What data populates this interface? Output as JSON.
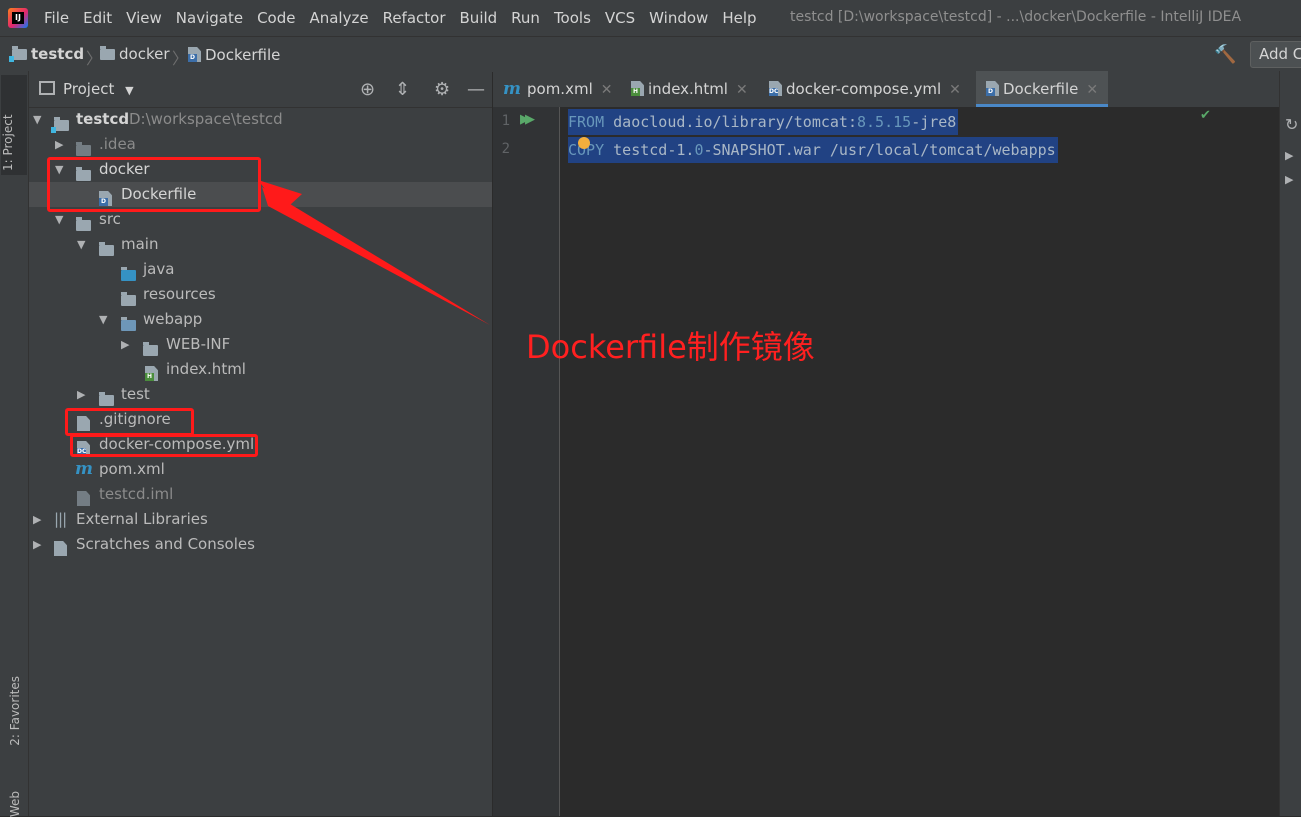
{
  "app": {
    "menu": [
      "File",
      "Edit",
      "View",
      "Navigate",
      "Code",
      "Analyze",
      "Refactor",
      "Build",
      "Run",
      "Tools",
      "VCS",
      "Window",
      "Help"
    ],
    "window_title": "testcd [D:\\workspace\\testcd] - ...\\docker\\Dockerfile - IntelliJ IDEA"
  },
  "navbar": {
    "crumbs": [
      "testcd",
      "docker",
      "Dockerfile"
    ],
    "add_config_label": "Add C"
  },
  "stripe": {
    "project_tab": "1: Project",
    "favorites_tab": "2: Favorites",
    "web_tab": "Web"
  },
  "project_panel": {
    "title": "Project",
    "tree": [
      {
        "label": "testcd",
        "path": "D:\\workspace\\testcd"
      },
      {
        "label": ".idea"
      },
      {
        "label": "docker"
      },
      {
        "label": "Dockerfile"
      },
      {
        "label": "src"
      },
      {
        "label": "main"
      },
      {
        "label": "java"
      },
      {
        "label": "resources"
      },
      {
        "label": "webapp"
      },
      {
        "label": "WEB-INF"
      },
      {
        "label": "index.html"
      },
      {
        "label": "test"
      },
      {
        "label": ".gitignore"
      },
      {
        "label": "docker-compose.yml"
      },
      {
        "label": "pom.xml"
      },
      {
        "label": "testcd.iml"
      },
      {
        "label": "External Libraries"
      },
      {
        "label": "Scratches and Consoles"
      }
    ]
  },
  "editor": {
    "tabs": [
      {
        "label": "pom.xml"
      },
      {
        "label": "index.html"
      },
      {
        "label": "docker-compose.yml"
      },
      {
        "label": "Dockerfile",
        "active": true
      }
    ],
    "line_numbers": [
      "1",
      "2"
    ],
    "lines": [
      {
        "kw": "FROM",
        "rest1": " daocloud.io/library/tomcat:",
        "num": "8.5.15",
        "rest2": "-jre8"
      },
      {
        "kw": "COPY",
        "rest1": " testcd-1.",
        "num": "0",
        "rest2": "-SNAPSHOT.war /usr/local/tomcat/webapps"
      }
    ]
  },
  "annotation": {
    "text": "Dockerfile制作镜像",
    "color": "#ff1a1a"
  },
  "colors": {
    "accent": "#4a88c7",
    "selection": "#214283",
    "annotation": "#ff1a1a"
  }
}
